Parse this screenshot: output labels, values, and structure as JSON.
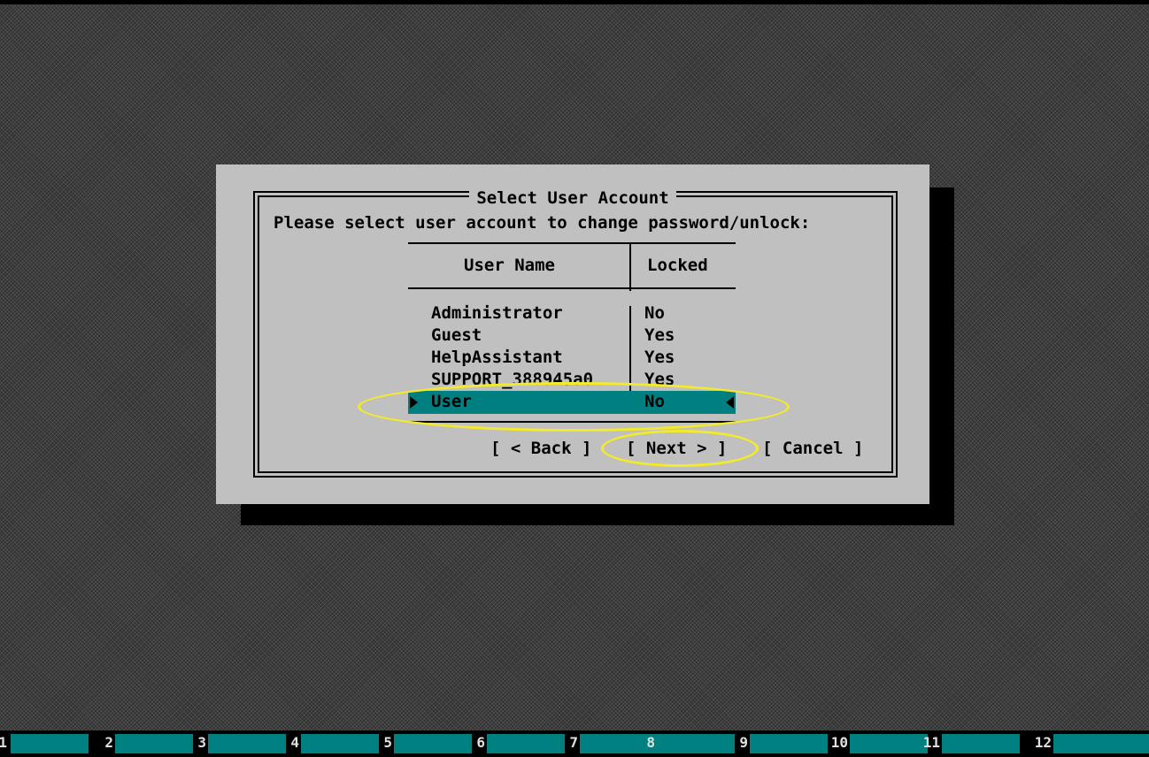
{
  "dialog": {
    "title": "Select User Account",
    "prompt": "Please select user account to change password/unlock:",
    "columns": {
      "user_name": "User Name",
      "locked": "Locked"
    },
    "rows": [
      {
        "user": "Administrator",
        "locked": "No"
      },
      {
        "user": "Guest",
        "locked": "Yes"
      },
      {
        "user": "HelpAssistant",
        "locked": "Yes"
      },
      {
        "user": "SUPPORT_388945a0",
        "locked": "Yes"
      },
      {
        "user": "User",
        "locked": "No",
        "selected": true
      }
    ],
    "buttons": {
      "back": "[ < Back ]",
      "next": "[ Next > ]",
      "cancel": "[ Cancel ]"
    }
  },
  "taskbar": {
    "consoles": [
      "1",
      "2",
      "3",
      "4",
      "5",
      "6",
      "7",
      "8",
      "9",
      "10",
      "11",
      "12"
    ]
  },
  "colors": {
    "dialog_bg": "#c0c0c0",
    "selection": "#007f80",
    "annotation": "#f2ea2a",
    "taskbar_tab": "#008080"
  }
}
